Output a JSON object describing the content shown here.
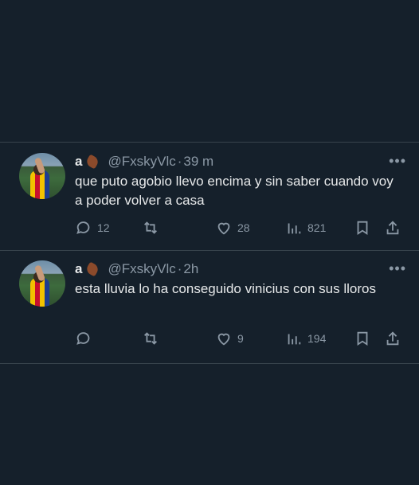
{
  "tweets": [
    {
      "name": "a",
      "handle": "@FxskyVlc",
      "dot": "·",
      "time": "39 m",
      "more": "•••",
      "text": "que puto agobio llevo encima y sin saber cuando voy a poder volver a casa",
      "replies": "12",
      "retweets": "",
      "likes": "28",
      "views": "821"
    },
    {
      "name": "a",
      "handle": "@FxskyVlc",
      "dot": "·",
      "time": "2h",
      "more": "•••",
      "text": "esta lluvia lo ha conseguido vinicius con sus lloros",
      "replies": "",
      "retweets": "",
      "likes": "9",
      "views": "194"
    }
  ],
  "colors": {
    "background": "#15202b",
    "text": "#e7e9ea",
    "muted": "#8b98a5",
    "divider": "#38444d"
  }
}
